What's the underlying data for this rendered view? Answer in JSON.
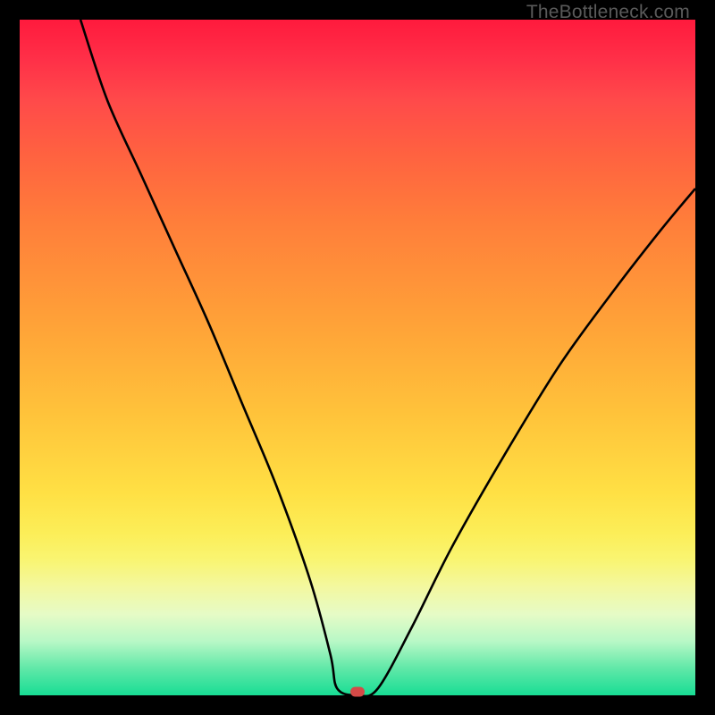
{
  "watermark": "TheBottleneck.com",
  "chart_data": {
    "type": "line",
    "title": "",
    "xlabel": "",
    "ylabel": "",
    "xlim": [
      0,
      100
    ],
    "ylim": [
      0,
      100
    ],
    "description": "A V-shaped bottleneck curve on a vertical rainbow gradient (red at top = bad, green at bottom = good). The curve descends steeply from upper-left, reaches a minimum near x≈50 (bottleneck≈0), and rises with a shallower slope toward upper-right.",
    "curve_points": [
      {
        "x": 9,
        "y": 100
      },
      {
        "x": 13,
        "y": 88
      },
      {
        "x": 18,
        "y": 77
      },
      {
        "x": 23,
        "y": 66
      },
      {
        "x": 28,
        "y": 55
      },
      {
        "x": 33,
        "y": 43
      },
      {
        "x": 38,
        "y": 31
      },
      {
        "x": 43,
        "y": 17
      },
      {
        "x": 46,
        "y": 6
      },
      {
        "x": 47,
        "y": 1
      },
      {
        "x": 50,
        "y": 0
      },
      {
        "x": 53,
        "y": 1
      },
      {
        "x": 58,
        "y": 10
      },
      {
        "x": 64,
        "y": 22
      },
      {
        "x": 72,
        "y": 36
      },
      {
        "x": 80,
        "y": 49
      },
      {
        "x": 88,
        "y": 60
      },
      {
        "x": 95,
        "y": 69
      },
      {
        "x": 100,
        "y": 75
      }
    ],
    "minimum_marker": {
      "x": 50,
      "y": 0,
      "color": "#d44a47"
    },
    "gradient_stops": [
      {
        "pos": 0,
        "color": "#ff1a3d"
      },
      {
        "pos": 50,
        "color": "#ffb038"
      },
      {
        "pos": 80,
        "color": "#f6f680"
      },
      {
        "pos": 100,
        "color": "#18dd94"
      }
    ]
  }
}
